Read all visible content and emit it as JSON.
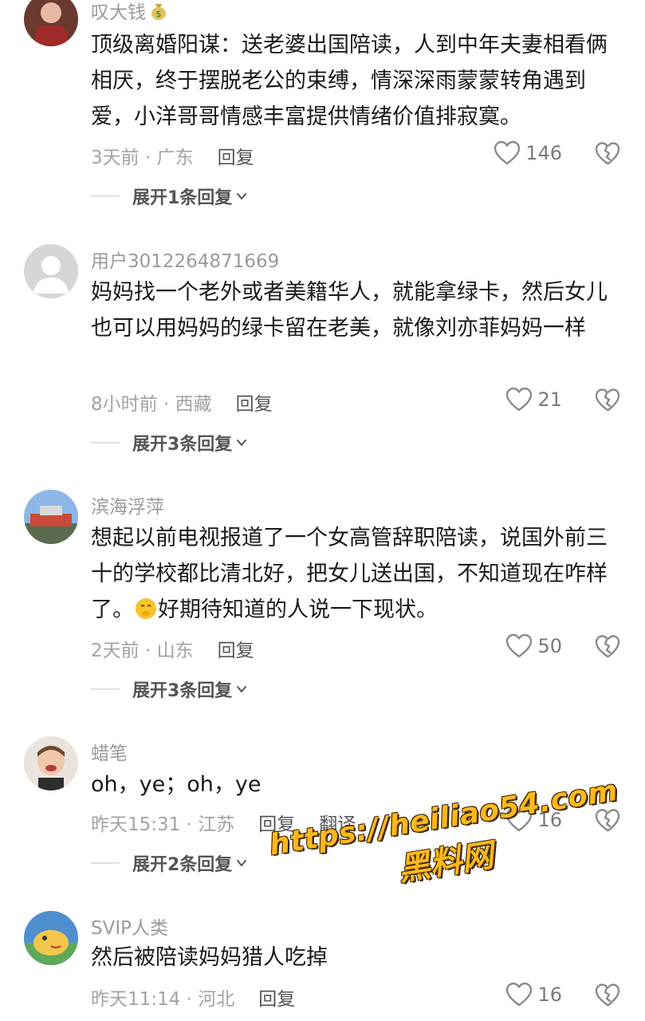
{
  "comments": [
    {
      "username": "叹大钱",
      "badge": "money-bag-icon",
      "text": "顶级离婚阳谋：送老婆出国陪读，人到中年夫妻相看俩相厌，终于摆脱老公的束缚，情深深雨蒙蒙转角遇到爱，小洋哥哥情感丰富提供情绪价值排寂寞。",
      "time_location": "3天前 · 广东",
      "reply_label": "回复",
      "likes": "146",
      "expand_label": "展开1条回复"
    },
    {
      "username": "用户3012264871669",
      "text": "妈妈找一个老外或者美籍华人，就能拿绿卡，然后女儿也可以用妈妈的绿卡留在老美，就像刘亦菲妈妈一样",
      "time_location": "8小时前 · 西藏",
      "reply_label": "回复",
      "likes": "21",
      "expand_label": "展开3条回复"
    },
    {
      "username": "滨海浮萍",
      "text_before_emoji": "想起以前电视报道了一个女高管辞职陪读，说国外前三十的学校都比清北好，把女儿送出国，不知道现在咋样了。",
      "emoji": "shushing-face-emoji",
      "text_after_emoji": "好期待知道的人说一下现状。",
      "time_location": "2天前 · 山东",
      "reply_label": "回复",
      "likes": "50",
      "expand_label": "展开3条回复"
    },
    {
      "username": "蜡笔",
      "text": "oh，ye；oh，ye",
      "time_location": "昨天15:31 · 江苏",
      "reply_label": "回复",
      "translate_label": "翻译",
      "likes": "16",
      "expand_label": "展开2条回复"
    },
    {
      "username": "SVIP人类",
      "text": "然后被陪读妈妈猎人吃掉",
      "time_location": "昨天11:14 · 河北",
      "reply_label": "回复",
      "likes": "16"
    }
  ],
  "watermark": {
    "url": "https://heiliao54.com",
    "name": "黑料网"
  },
  "colors": {
    "text": "#1a1a1a",
    "meta": "#a3a3a3",
    "watermark": "#ffb81c"
  }
}
